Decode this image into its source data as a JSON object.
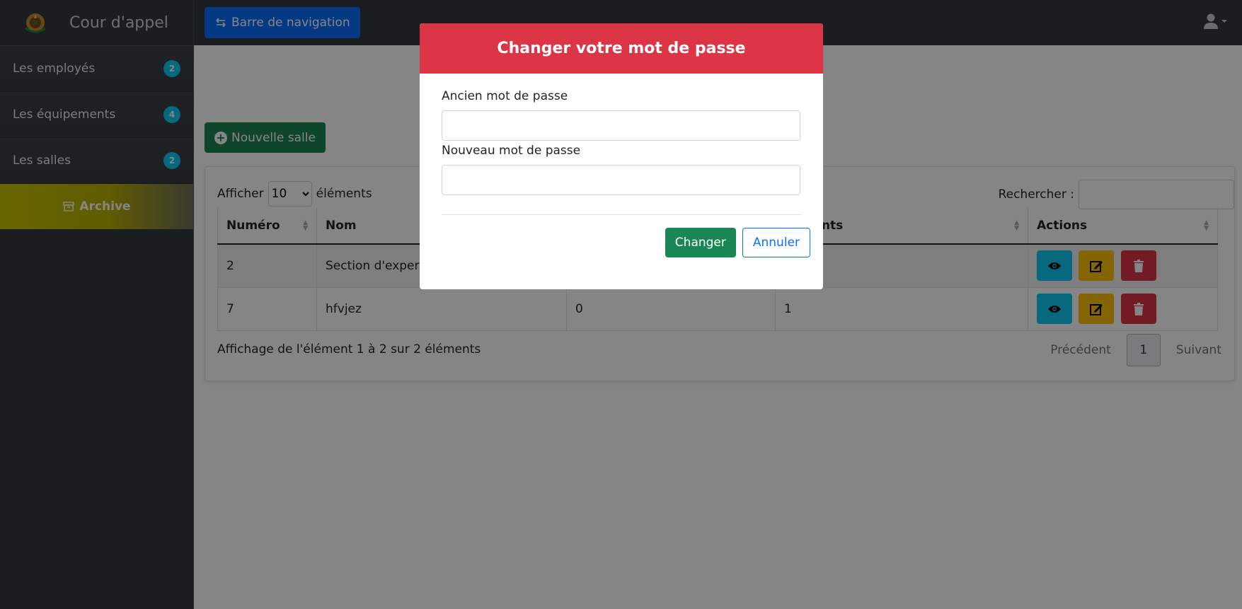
{
  "brand": {
    "title": "Cour d'appel",
    "logo": "emblem-logo"
  },
  "sidebar": {
    "items": [
      {
        "label": "Les employés",
        "badge": "2"
      },
      {
        "label": "Les équipements",
        "badge": "4"
      },
      {
        "label": "Les salles",
        "badge": "2"
      }
    ],
    "archive_label": "Archive"
  },
  "topbar": {
    "nav_button": "Barre de navigation",
    "user_icon": "user-icon"
  },
  "main": {
    "new_button": "Nouvelle salle",
    "length": {
      "prefix": "Afficher",
      "value": "10",
      "suffix": "éléments"
    },
    "search": {
      "label": "Rechercher :",
      "value": ""
    },
    "columns": [
      "Numéro",
      "Nom",
      "",
      "pements",
      "Actions"
    ],
    "rows": [
      {
        "num": "2",
        "nom": "Section d'expert",
        "col3": "",
        "col4": ""
      },
      {
        "num": "7",
        "nom": "hfvjez",
        "col3": "0",
        "col4": "1"
      }
    ],
    "info": "Affichage de l'élément 1 à 2 sur 2 éléments",
    "pager": {
      "prev": "Précédent",
      "page": "1",
      "next": "Suivant"
    }
  },
  "modal": {
    "title": "Changer votre mot de passe",
    "old_label": "Ancien mot de passe",
    "old_value": "",
    "new_label": "Nouveau mot de passe",
    "new_value": "",
    "confirm": "Changer",
    "cancel": "Annuler"
  },
  "colors": {
    "danger": "#dc3545",
    "success": "#198754",
    "primary": "#0d6efd",
    "info": "#0dcaf0",
    "warning": "#ffc107",
    "sidebar": "#343a40"
  }
}
